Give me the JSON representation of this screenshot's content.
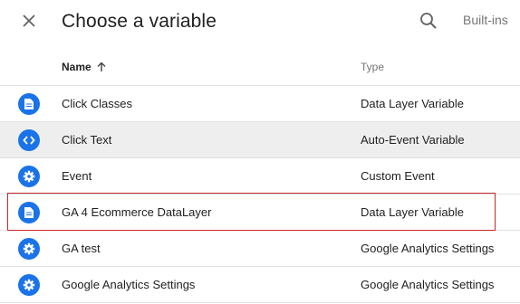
{
  "dialog": {
    "title": "Choose a variable",
    "builtins_label": "Built-ins"
  },
  "columns": {
    "name_label": "Name",
    "type_label": "Type"
  },
  "rows": [
    {
      "name": "Click Classes",
      "type": "Data Layer Variable",
      "icon": "document-icon"
    },
    {
      "name": "Click Text",
      "type": "Auto-Event Variable",
      "icon": "code-icon"
    },
    {
      "name": "Event",
      "type": "Custom Event",
      "icon": "gear-icon"
    },
    {
      "name": "GA 4 Ecommerce DataLayer",
      "type": "Data Layer Variable",
      "icon": "document-icon"
    },
    {
      "name": "GA test",
      "type": "Google Analytics Settings",
      "icon": "gear-icon"
    },
    {
      "name": "Google Analytics Settings",
      "type": "Google Analytics Settings",
      "icon": "gear-icon"
    }
  ],
  "colors": {
    "icon_blue": "#1a73e8",
    "highlight_red": "#c62828"
  }
}
